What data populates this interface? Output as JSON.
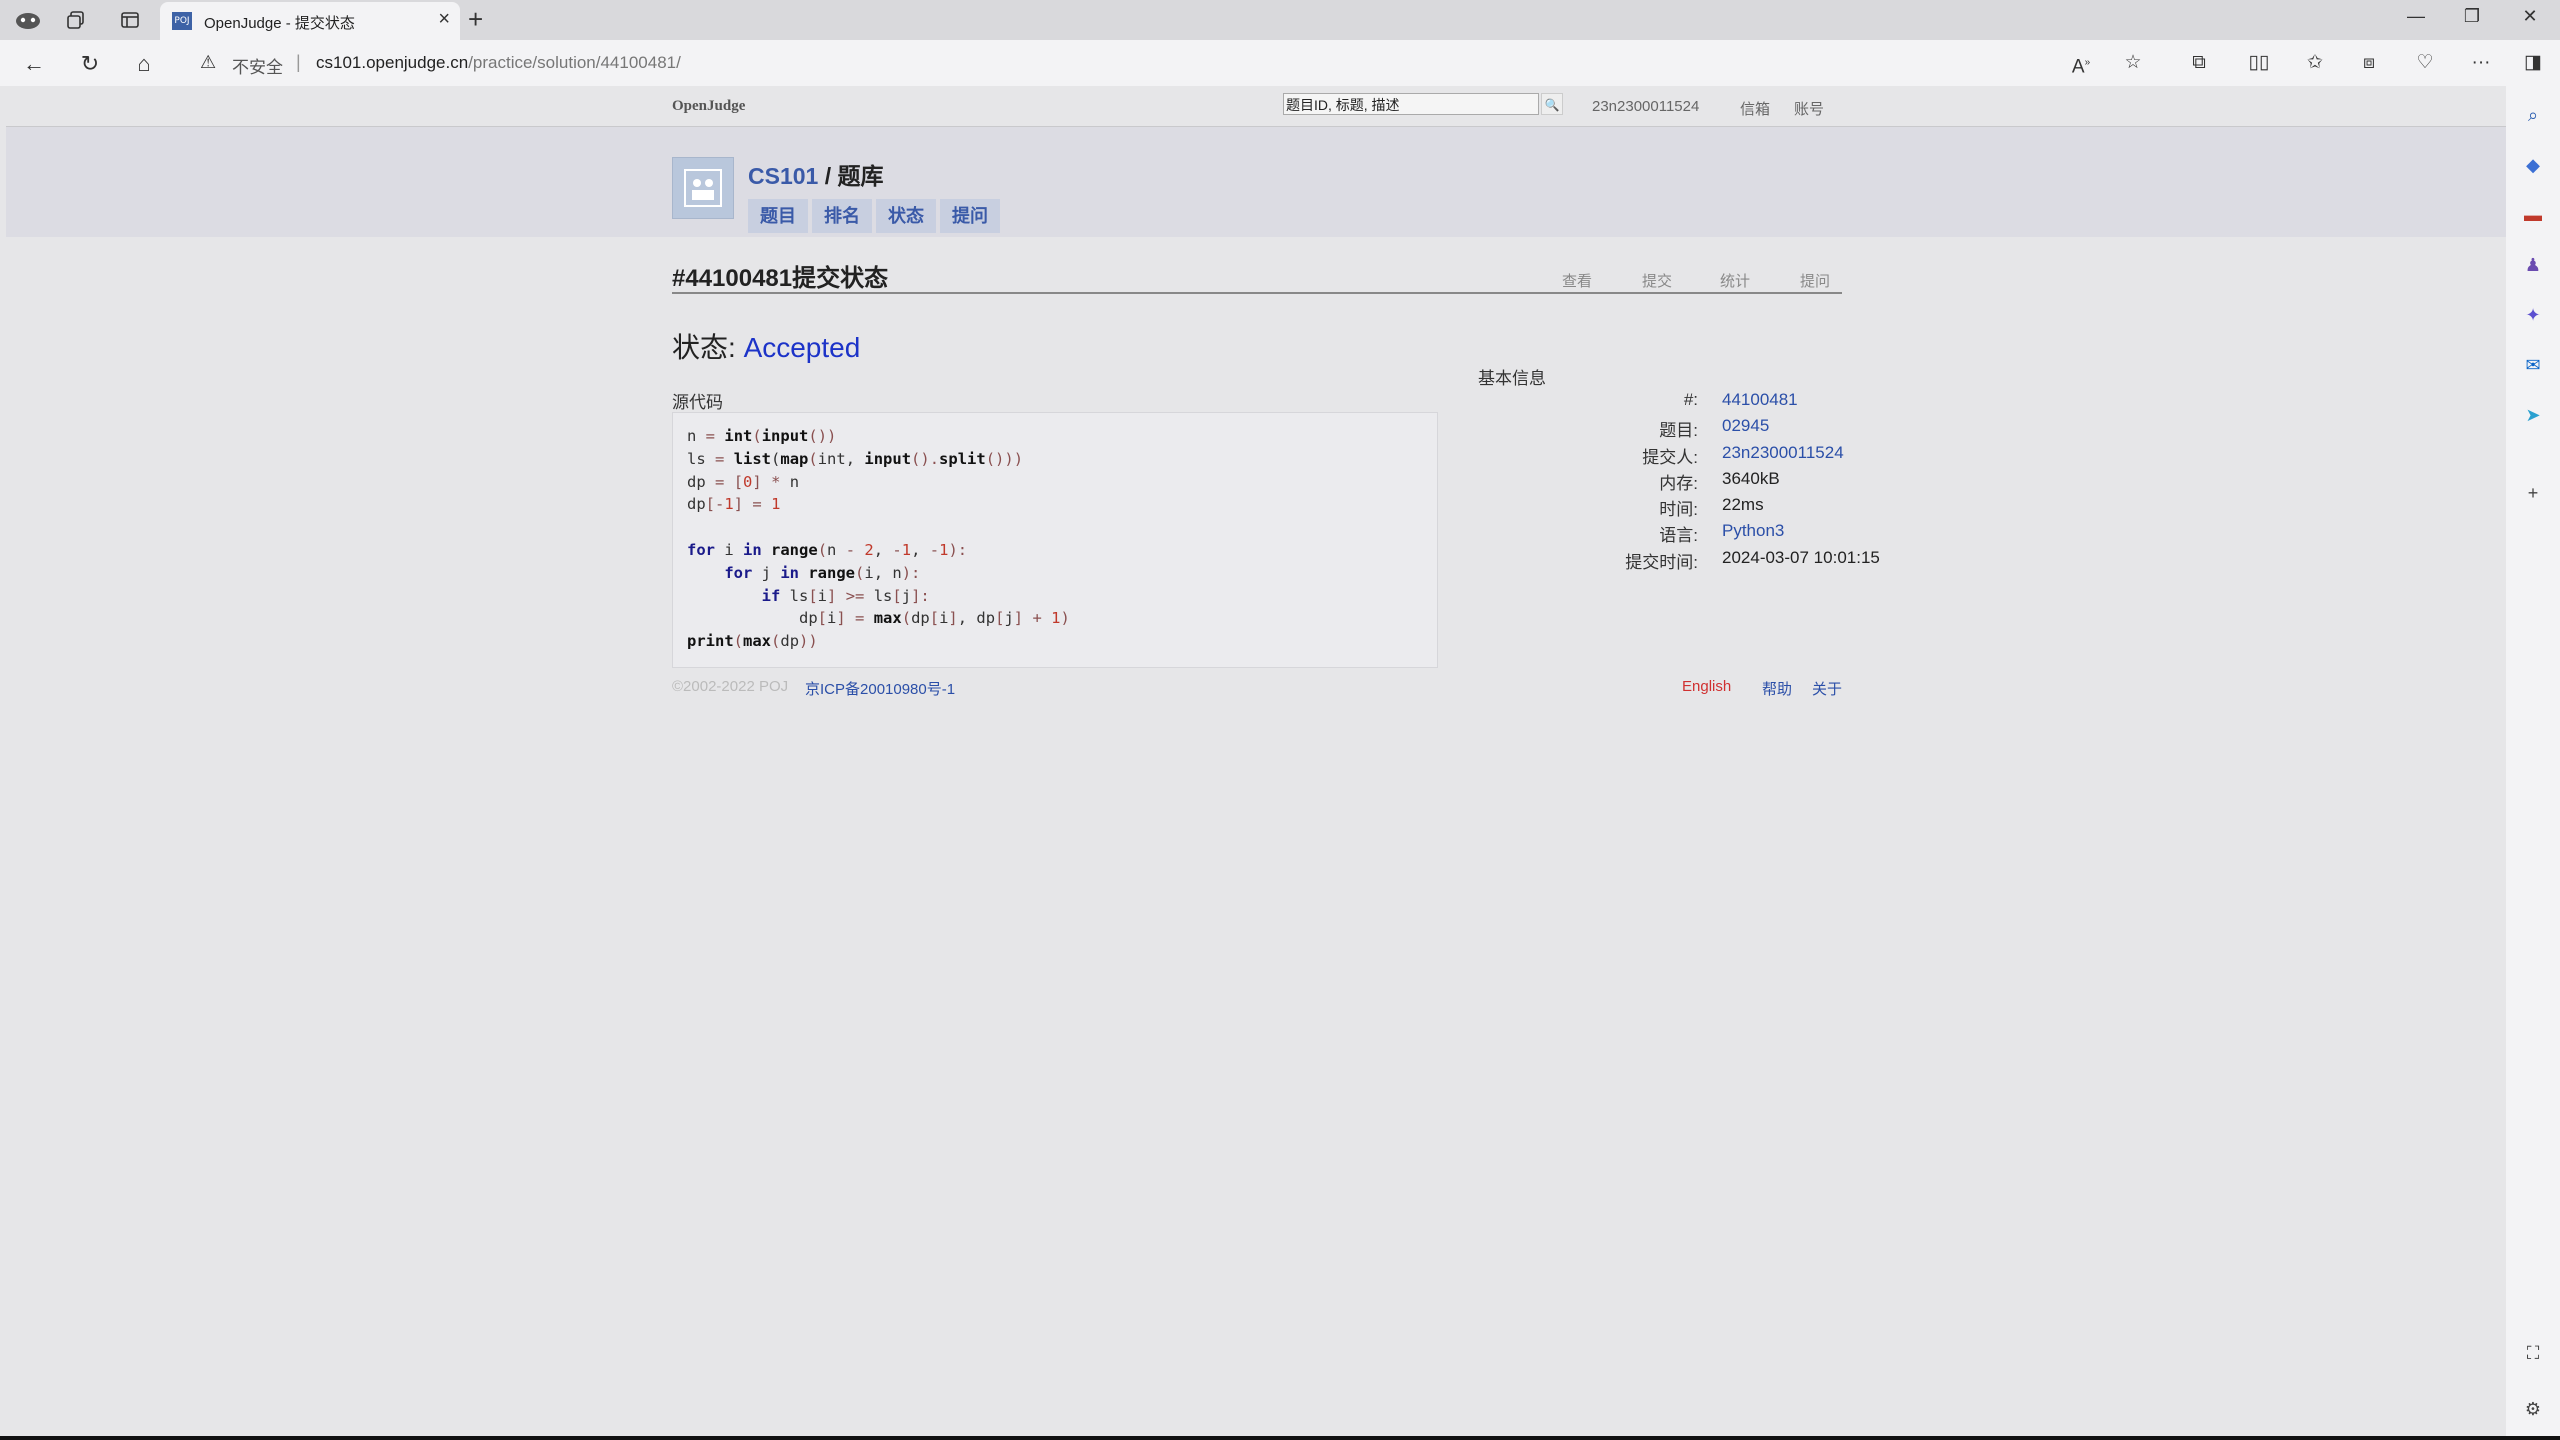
{
  "browser": {
    "tab_title": "OpenJudge - 提交状态",
    "tab_favicon": "POJ",
    "insecure_label": "不安全",
    "url_host": "cs101.openjudge.cn",
    "url_path": "/practice/solution/44100481/"
  },
  "topnav": {
    "brand": "OpenJudge",
    "search_value": "题目ID, 标题, 描述",
    "user": "23n2300011524",
    "mail": "信箱",
    "account": "账号"
  },
  "course": {
    "name": "CS101",
    "slash": " / ",
    "section": "题库",
    "tabs": [
      "题目",
      "排名",
      "状态",
      "提问"
    ]
  },
  "solution": {
    "title": "#44100481提交状态",
    "subnav": [
      "查看",
      "提交",
      "统计",
      "提问"
    ],
    "status_label": "状态: ",
    "status_value": "Accepted",
    "source_label": "源代码"
  },
  "info": {
    "title": "基本信息",
    "rows": [
      {
        "key": "#:",
        "value": "44100481",
        "link": true
      },
      {
        "key": "题目:",
        "value": "02945",
        "link": true
      },
      {
        "key": "提交人:",
        "value": "23n2300011524",
        "link": true
      },
      {
        "key": "内存:",
        "value": "3640kB",
        "link": false
      },
      {
        "key": "时间:",
        "value": "22ms",
        "link": false
      },
      {
        "key": "语言:",
        "value": "Python3",
        "link": true
      },
      {
        "key": "提交时间:",
        "value": "2024-03-07 10:01:15",
        "link": false
      }
    ]
  },
  "footer": {
    "copyright": "©2002-2022 POJ",
    "icp": "京ICP备20010980号-1",
    "english": "English",
    "help": "帮助",
    "about": "关于"
  },
  "colors": {
    "accent": "#3a5aa8",
    "accepted": "#1c33c8",
    "background": "#e6e6e8"
  }
}
